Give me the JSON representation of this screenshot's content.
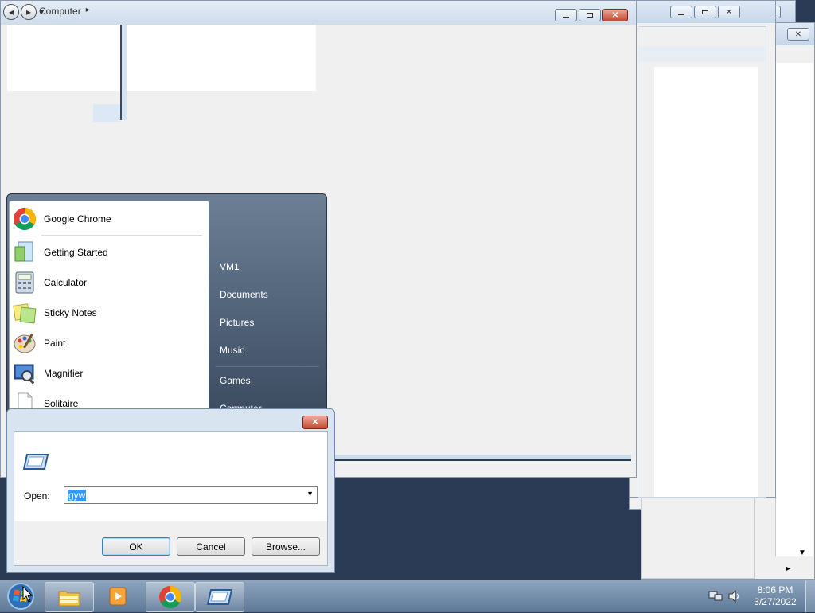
{
  "background_windows": {
    "controls": [
      "minimize",
      "maximize",
      "close"
    ]
  },
  "explorer": {
    "breadcrumb": "Computer",
    "breadcrumb_arrow": "▸"
  },
  "start_menu": {
    "programs": [
      {
        "label": "Google Chrome",
        "icon": "chrome-icon"
      },
      {
        "label": "Getting Started",
        "icon": "getting-started-icon"
      },
      {
        "label": "Calculator",
        "icon": "calculator-icon"
      },
      {
        "label": "Sticky Notes",
        "icon": "sticky-notes-icon"
      },
      {
        "label": "Paint",
        "icon": "paint-icon"
      },
      {
        "label": "Magnifier",
        "icon": "magnifier-icon"
      },
      {
        "label": "Solitaire",
        "icon": "solitaire-icon"
      }
    ],
    "right": {
      "user": "VM1",
      "documents": "Documents",
      "pictures": "Pictures",
      "music": "Music",
      "games": "Games",
      "computer": "Computer"
    }
  },
  "run_dialog": {
    "close_label": "✕",
    "open_label": "Open:",
    "open_value": "gyw",
    "ok_label": "OK",
    "cancel_label": "Cancel",
    "browse_label": "Browse..."
  },
  "taskbar": {
    "time": "8:06 PM",
    "date": "3/27/2022"
  }
}
